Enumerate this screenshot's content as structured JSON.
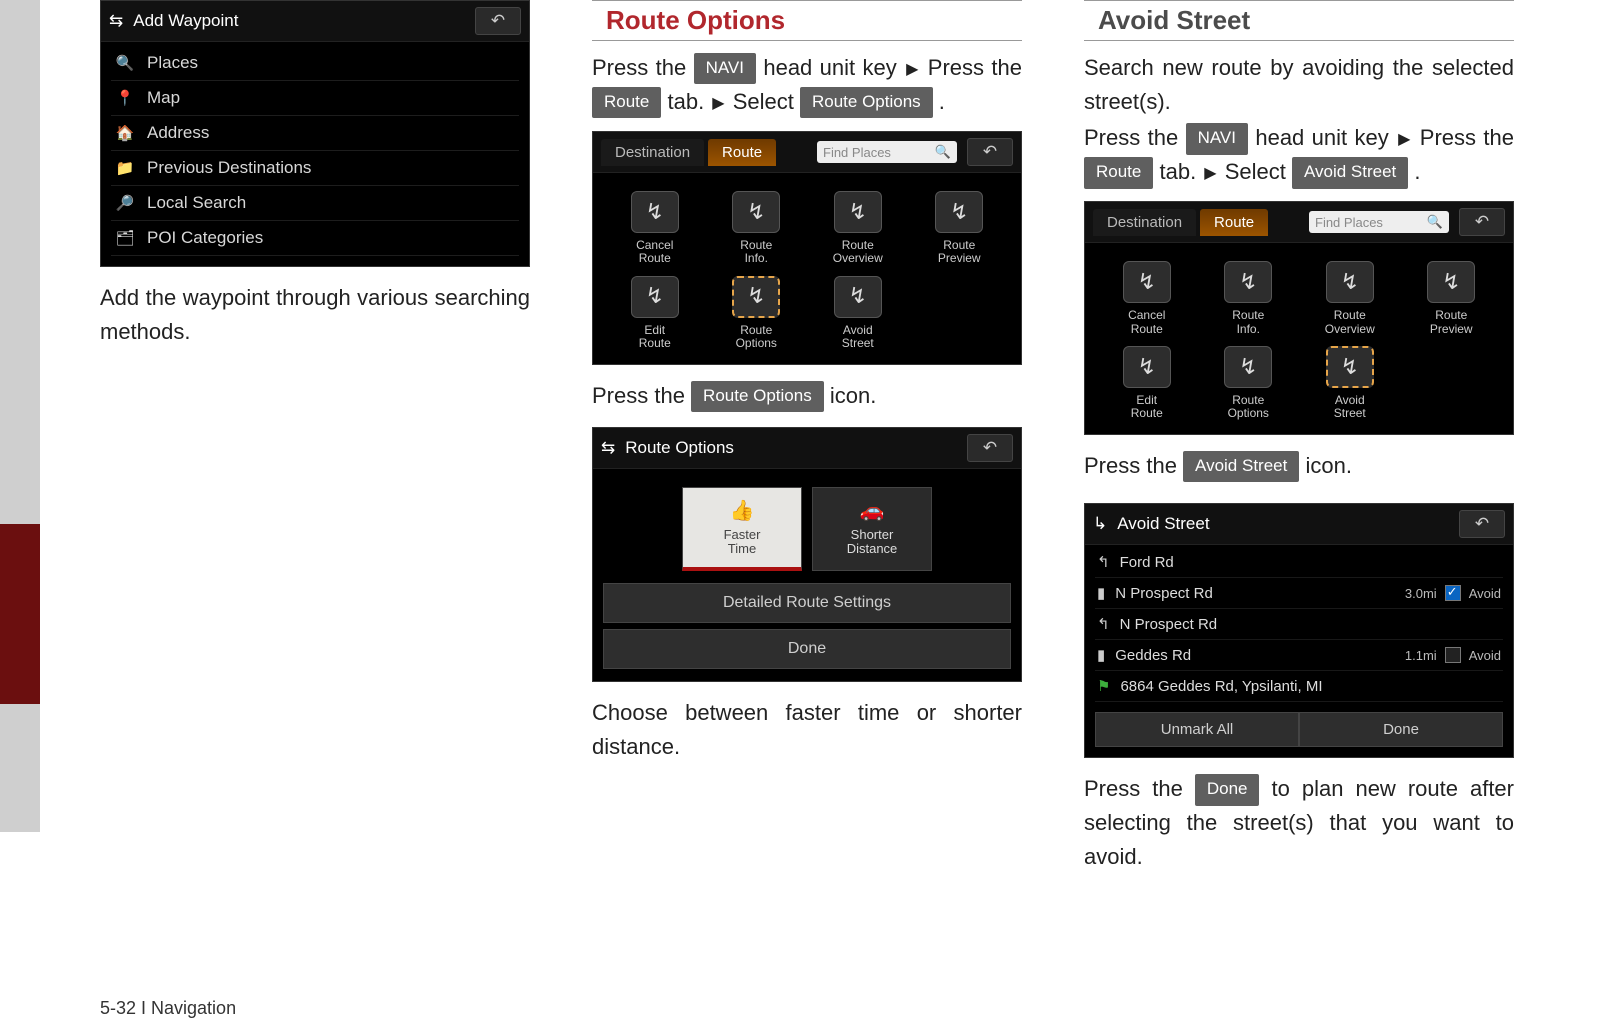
{
  "footer": "5-32 I Navigation",
  "col1": {
    "waypoint": {
      "title": "Add Waypoint",
      "items": [
        {
          "icon": "🔍",
          "name": "places-icon",
          "label": "Places"
        },
        {
          "icon": "📍",
          "name": "map-icon",
          "label": "Map"
        },
        {
          "icon": "🏠",
          "name": "address-icon",
          "label": "Address"
        },
        {
          "icon": "📁",
          "name": "previous-destinations-icon",
          "label": "Previous Destinations"
        },
        {
          "icon": "🔎",
          "name": "local-search-icon",
          "label": "Local Search"
        },
        {
          "icon": "🗂",
          "name": "poi-categories-icon",
          "label": "POI Categories"
        }
      ]
    },
    "caption": "Add the waypoint through various search­ing methods."
  },
  "col2": {
    "heading": "Route Options",
    "para1": {
      "t1": "Press  the ",
      "k1": "NAVI",
      "t2": " head unit key ",
      "t3": " Press the ",
      "k2": "Route",
      "t4": " tab. ",
      "t5": " Select ",
      "k3": "Route Options",
      "t6": " ."
    },
    "route_screen": {
      "tabs": {
        "dest": "Destination",
        "route": "Route"
      },
      "find": "Find Places",
      "cells": [
        {
          "l1": "Cancel",
          "l2": "Route"
        },
        {
          "l1": "Route",
          "l2": "Info."
        },
        {
          "l1": "Route",
          "l2": "Overview"
        },
        {
          "l1": "Route",
          "l2": "Preview"
        },
        {
          "l1": "Edit",
          "l2": "Route"
        },
        {
          "l1": "Route",
          "l2": "Options",
          "hl": true
        },
        {
          "l1": "Avoid",
          "l2": "Street"
        }
      ]
    },
    "para2": {
      "t1": "Press the ",
      "k1": "Route Options",
      "t2": " icon."
    },
    "options_screen": {
      "title": "Route Options",
      "faster": "Faster\nTime",
      "shorter": "Shorter\nDistance",
      "detailed": "Detailed Route Settings",
      "done": "Done"
    },
    "caption2": "Choose between faster time or shorter distance."
  },
  "col3": {
    "heading": "Avoid Street",
    "para1": "Search new route by avoiding the selected street(s).",
    "para2": {
      "t1": "Press  the ",
      "k1": "NAVI",
      "t2": " head unit key ",
      "t3": " Press the  ",
      "k2": "Route",
      "t4": " tab. ",
      "t5": " Select  ",
      "k3": "Avoid Street",
      "t6": " ."
    },
    "route_screen": {
      "tabs": {
        "dest": "Destination",
        "route": "Route"
      },
      "find": "Find Places",
      "cells": [
        {
          "l1": "Cancel",
          "l2": "Route"
        },
        {
          "l1": "Route",
          "l2": "Info."
        },
        {
          "l1": "Route",
          "l2": "Overview"
        },
        {
          "l1": "Route",
          "l2": "Preview"
        },
        {
          "l1": "Edit",
          "l2": "Route"
        },
        {
          "l1": "Route",
          "l2": "Options"
        },
        {
          "l1": "Avoid",
          "l2": "Street",
          "hl": true
        }
      ]
    },
    "para3": {
      "t1": "Press the ",
      "k1": "Avoid Street",
      "t2": "  icon."
    },
    "avoid_screen": {
      "title": "Avoid Street",
      "rows": [
        {
          "icon": "↰",
          "label": "Ford Rd"
        },
        {
          "icon": "▮",
          "label": "N Prospect Rd",
          "dist": "3.0mi",
          "avoid": true,
          "checked": true
        },
        {
          "icon": "↰",
          "label": "N Prospect Rd"
        },
        {
          "icon": "▮",
          "label": "Geddes Rd",
          "dist": "1.1mi",
          "avoid": true,
          "checked": false
        },
        {
          "icon": "⚑",
          "label": "6864 Geddes Rd, Ypsilanti, MI",
          "flag": true
        }
      ],
      "unmark": "Unmark All",
      "done": "Done"
    },
    "para4": {
      "t1": "Press the ",
      "k1": "Done",
      "t2": " to plan new route after selecting the street(s) that you want to avoid."
    }
  },
  "avoid_label": "Avoid"
}
